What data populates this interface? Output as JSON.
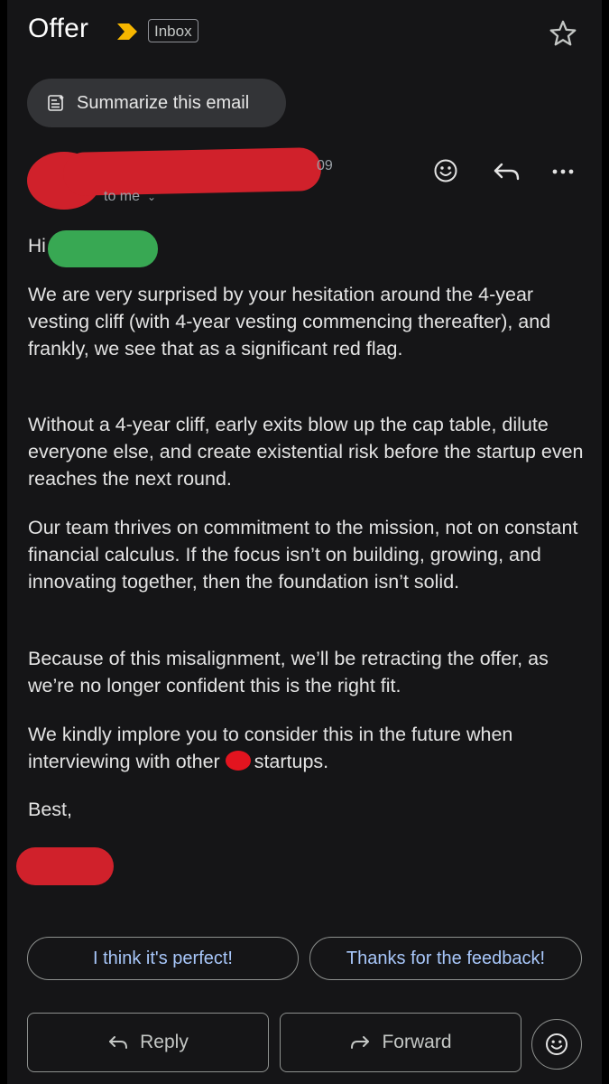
{
  "header": {
    "subject": "Offer",
    "label_chip": "Inbox",
    "importance_icon": "importance-marker-icon",
    "star_icon": "star-icon"
  },
  "summarize": {
    "label": "Summarize this email",
    "icon": "summarize-icon"
  },
  "message": {
    "sender_time_fragment": "09",
    "recipient": "to me",
    "actions": [
      "emoji-reaction-icon",
      "reply-icon",
      "more-options-icon"
    ],
    "greeting": "Hi",
    "paragraphs": [
      "We are very surprised by your hesitation around the 4-year vesting cliff (with 4-year vesting commencing thereafter), and frankly, we see that as a significant red flag.",
      "Without a 4-year cliff, early exits blow up the cap table, dilute everyone else, and create existential risk before the startup even reaches the next round.",
      "Our team thrives on commitment to the mission, not on constant financial calculus. If the focus isn’t on building, growing, and innovating together, then the foundation isn’t solid.",
      "Because of this misalignment, we’ll be retracting the offer, as we’re no longer confident this is the right fit."
    ],
    "last_paragraph_before": "We kindly implore you to consider this in the future when interviewing with other",
    "last_paragraph_after": "startups.",
    "signoff": "Best,"
  },
  "smart_replies": [
    "I think it's perfect!",
    "Thanks for the feedback!"
  ],
  "bottom_actions": {
    "reply_label": "Reply",
    "forward_label": "Forward",
    "emoji_icon": "emoji-icon"
  },
  "colors": {
    "background": "#151517",
    "smart_reply_text": "#a8c7fa",
    "redaction_red": "#d0212b",
    "redaction_green": "#38a853",
    "importance_marker": "#f6b600"
  }
}
